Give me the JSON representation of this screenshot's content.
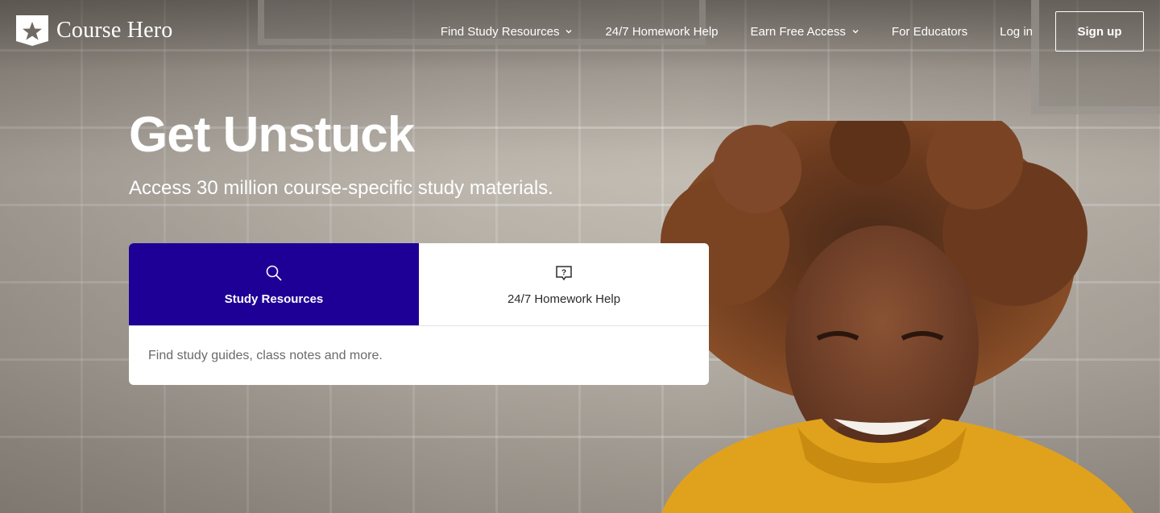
{
  "header": {
    "brand": "Course Hero",
    "nav": [
      {
        "label": "Find Study Resources",
        "has_dropdown": true
      },
      {
        "label": "24/7 Homework Help",
        "has_dropdown": false
      },
      {
        "label": "Earn Free Access",
        "has_dropdown": true
      },
      {
        "label": "For Educators",
        "has_dropdown": false
      },
      {
        "label": "Log in",
        "has_dropdown": false
      }
    ],
    "signup_label": "Sign up"
  },
  "hero": {
    "title": "Get Unstuck",
    "subtitle": "Access 30 million course-specific study materials."
  },
  "search_card": {
    "tabs": [
      {
        "label": "Study Resources",
        "icon": "search-icon",
        "active": true
      },
      {
        "label": "24/7 Homework Help",
        "icon": "question-bubble-icon",
        "active": false
      }
    ],
    "placeholder": "Find study guides, class notes and more."
  },
  "colors": {
    "active_tab": "#1e0096",
    "text_on_dark": "#ffffff",
    "placeholder_text": "#6a6a6a"
  }
}
